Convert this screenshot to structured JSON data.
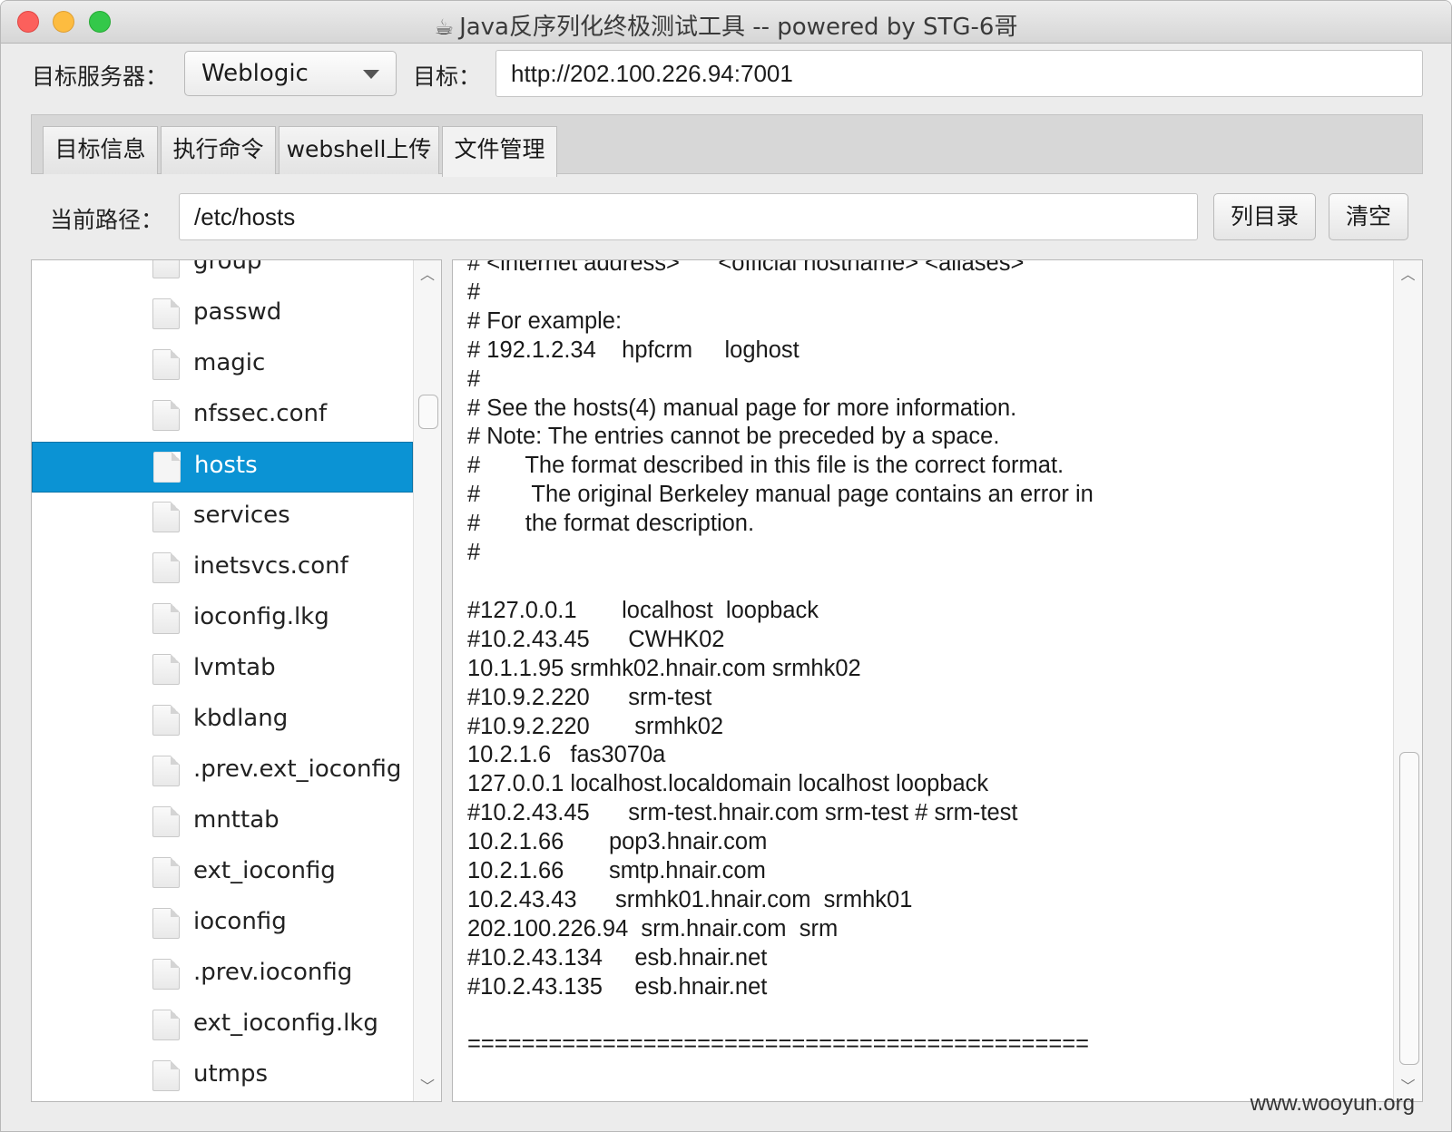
{
  "window": {
    "title": "Java反序列化终极测试工具  -- powered by STG-6哥",
    "title_icon": "coffee-cup-icon"
  },
  "toolbar": {
    "server_label": "目标服务器：",
    "server_value": "Weblogic",
    "target_label": "目标：",
    "target_value": "http://202.100.226.94:7001"
  },
  "tabs": [
    {
      "label": "目标信息",
      "active": false
    },
    {
      "label": "执行命令",
      "active": false
    },
    {
      "label": "webshell上传",
      "active": false
    },
    {
      "label": "文件管理",
      "active": true
    }
  ],
  "path": {
    "label": "当前路径：",
    "value": "/etc/hosts",
    "list_button": "列目录",
    "clear_button": "清空"
  },
  "files": [
    {
      "name": "group"
    },
    {
      "name": "passwd"
    },
    {
      "name": "magic"
    },
    {
      "name": "nfssec.conf"
    },
    {
      "name": "hosts",
      "selected": true
    },
    {
      "name": "services"
    },
    {
      "name": "inetsvcs.conf"
    },
    {
      "name": "ioconfig.lkg"
    },
    {
      "name": "lvmtab"
    },
    {
      "name": "kbdlang"
    },
    {
      "name": ".prev.ext_ioconfig"
    },
    {
      "name": "mnttab"
    },
    {
      "name": "ext_ioconfig"
    },
    {
      "name": "ioconfig"
    },
    {
      "name": ".prev.ioconfig"
    },
    {
      "name": "ext_ioconfig.lkg"
    },
    {
      "name": "utmps"
    }
  ],
  "file_content": "# <internet address>      <official hostname> <aliases>\n#\n# For example:\n# 192.1.2.34    hpfcrm     loghost\n#\n# See the hosts(4) manual page for more information.\n# Note: The entries cannot be preceded by a space.\n#       The format described in this file is the correct format.\n#        The original Berkeley manual page contains an error in\n#       the format description.\n#\n\n#127.0.0.1       localhost  loopback\n#10.2.43.45      CWHK02\n10.1.1.95 srmhk02.hnair.com srmhk02\n#10.9.2.220      srm-test\n#10.9.2.220       srmhk02\n10.2.1.6   fas3070a\n127.0.0.1 localhost.localdomain localhost loopback\n#10.2.43.45      srm-test.hnair.com srm-test # srm-test\n10.2.1.66       pop3.hnair.com\n10.2.1.66       smtp.hnair.com\n10.2.43.43      srmhk01.hnair.com  srmhk01\n202.100.226.94  srm.hnair.com  srm\n#10.2.43.134     esb.hnair.net\n#10.2.43.135     esb.hnair.net\n\n==============================================",
  "watermark": "www.wooyun.org"
}
